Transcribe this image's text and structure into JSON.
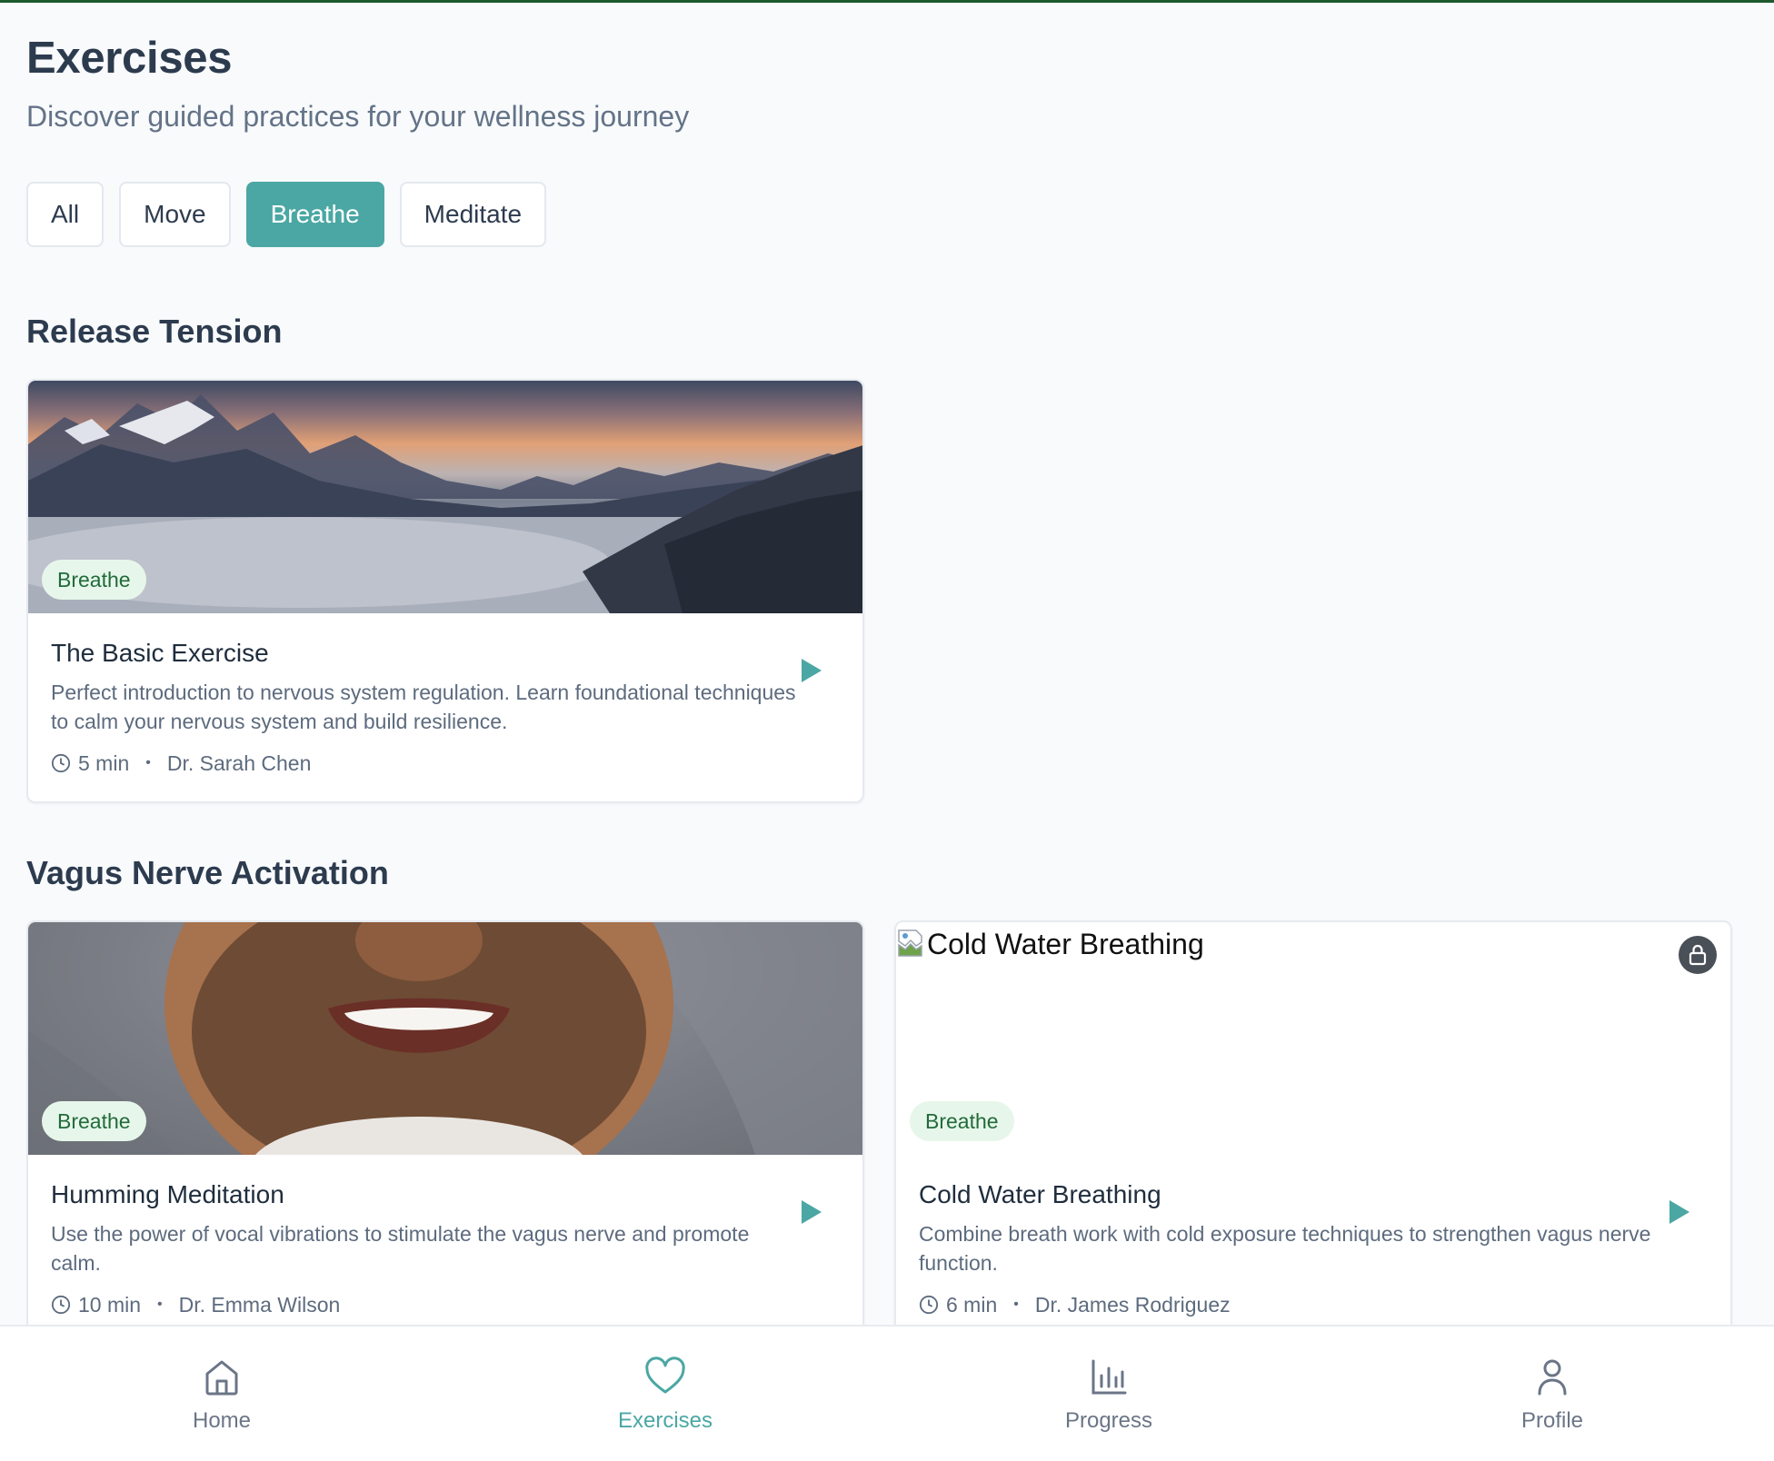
{
  "header": {
    "title": "Exercises",
    "subtitle": "Discover guided practices for your wellness journey"
  },
  "filters": [
    {
      "label": "All",
      "active": false
    },
    {
      "label": "Move",
      "active": false
    },
    {
      "label": "Breathe",
      "active": true
    },
    {
      "label": "Meditate",
      "active": false
    }
  ],
  "sections": [
    {
      "title": "Release Tension",
      "cards": [
        {
          "image": "mountain-sunset-photo",
          "tag": "Breathe",
          "title": "The Basic Exercise",
          "description": "Perfect introduction to nervous system regulation. Learn foundational techniques to calm your nervous system and build resilience.",
          "duration": "5 min",
          "author": "Dr. Sarah Chen",
          "locked": false
        }
      ]
    },
    {
      "title": "Vagus Nerve Activation",
      "cards": [
        {
          "image": "smiling-man-photo",
          "tag": "Breathe",
          "title": "Humming Meditation",
          "description": "Use the power of vocal vibrations to stimulate the vagus nerve and promote calm.",
          "duration": "10 min",
          "author": "Dr. Emma Wilson",
          "locked": false
        },
        {
          "image_alt": "Cold Water Breathing",
          "tag": "Breathe",
          "title": "Cold Water Breathing",
          "description": "Combine breath work with cold exposure techniques to strengthen vagus nerve function.",
          "duration": "6 min",
          "author": "Dr. James Rodriguez",
          "locked": true
        }
      ]
    }
  ],
  "bottom_nav": [
    {
      "label": "Home",
      "icon": "home-icon",
      "active": false
    },
    {
      "label": "Exercises",
      "icon": "heart-icon",
      "active": true
    },
    {
      "label": "Progress",
      "icon": "bar-chart-icon",
      "active": false
    },
    {
      "label": "Profile",
      "icon": "user-icon",
      "active": false
    }
  ],
  "colors": {
    "accent": "#4ba7a3",
    "tag_bg": "#e7f6ea",
    "tag_text": "#216b3a",
    "title_text": "#2d3b4e",
    "muted_text": "#647387"
  }
}
